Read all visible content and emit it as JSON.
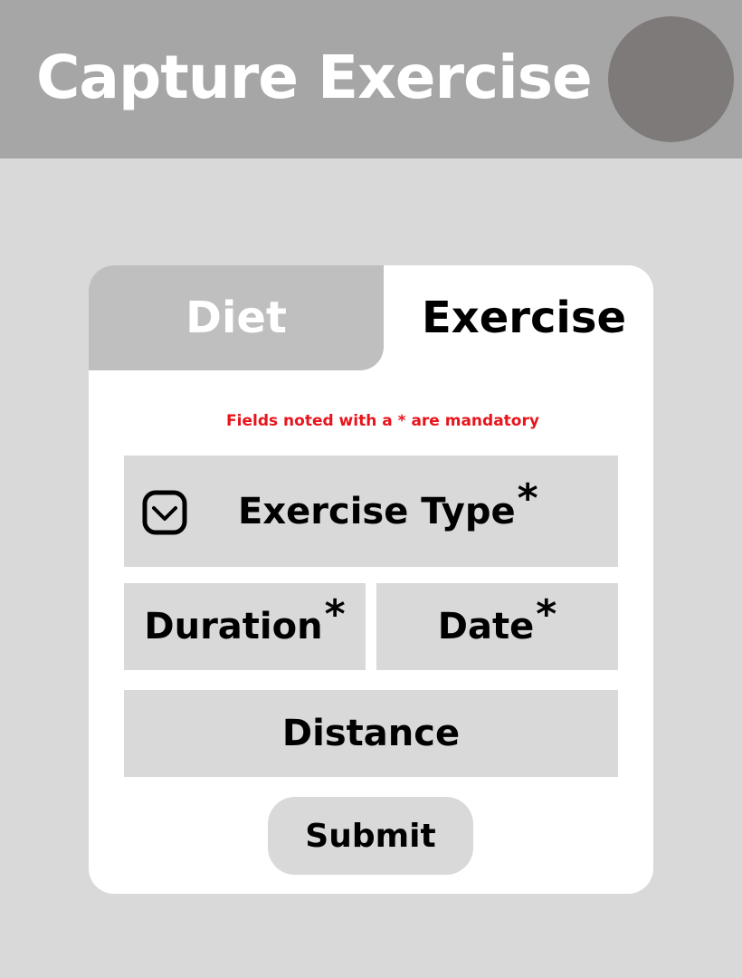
{
  "header": {
    "title": "Capture Exercise"
  },
  "tabs": {
    "diet": "Diet",
    "exercise": "Exercise"
  },
  "form": {
    "mandatory_note": "Fields noted with a * are mandatory",
    "exercise_type_label": "Exercise Type",
    "duration_label": "Duration",
    "date_label": "Date",
    "distance_label": "Distance",
    "required_marker": "*",
    "submit_label": "Submit"
  },
  "icons": {
    "dropdown": "chevron-down-icon",
    "avatar": "avatar"
  },
  "colors": {
    "header_bg": "#a6a6a6",
    "page_bg": "#d9d9d9",
    "avatar": "#7f7a7a",
    "active_tab_text": "#000000",
    "inactive_tab_bg": "#bfbfbf",
    "note_text": "#e8141b"
  }
}
